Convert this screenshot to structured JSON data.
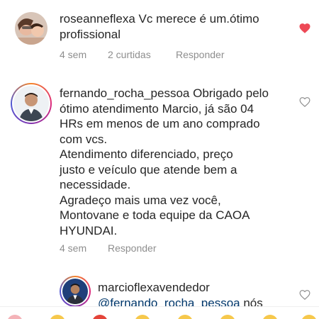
{
  "comments": [
    {
      "username": "roseanneflexa",
      "text": " Vc merece é um.ótimo profissional",
      "time": "4 sem",
      "shares": "2 curtidas",
      "reply": "Responder",
      "liked": true,
      "heart_icon": "heart-filled-icon",
      "heart_color": "#ed4956"
    },
    {
      "username": "fernando_rocha_pessoa",
      "text_lines": [
        " Obrigado pelo",
        "ótimo atendimento Marcio, já são 04",
        "HRs em menos de um ano comprado",
        "com vcs.",
        "Atendimento diferenciado, preço",
        "justo e veículo que atende bem a",
        "necessidade.",
        "Agradeço mais uma vez você,",
        "Montovane e toda equipe da CAOA",
        "HYUNDAI."
      ],
      "time": "4 sem",
      "reply": "Responder",
      "liked": false,
      "heart_icon": "heart-outline-icon"
    },
    {
      "username": "marcioflexavendedor",
      "mention": "@fernando_rocha_pessoa",
      "text_tail": " nós",
      "liked": false,
      "heart_icon": "heart-outline-icon"
    }
  ],
  "colors": {
    "text": "#262626",
    "muted": "#8e8e8e",
    "mention": "#00376b",
    "story_ring": "#c13584"
  }
}
